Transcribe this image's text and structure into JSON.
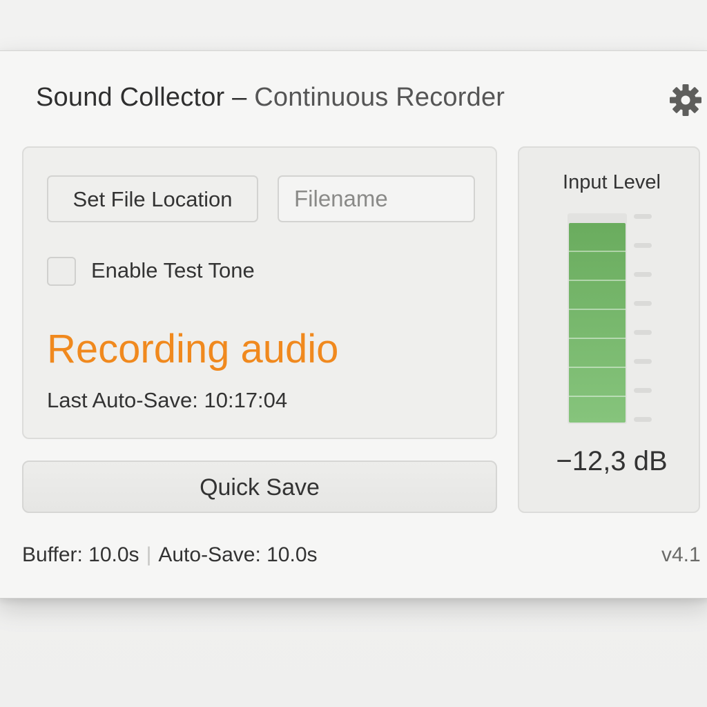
{
  "window": {
    "title_main": "Sound Collector",
    "title_dash": " – ",
    "title_sub": "Continuous Recorder",
    "settings_icon": "gear-icon"
  },
  "controls": {
    "set_location_label": "Set File Location",
    "filename_placeholder": "Filename",
    "filename_value": "",
    "test_tone_label": "Enable Test Tone",
    "test_tone_checked": false
  },
  "status": {
    "text": "Recording audio",
    "color": "#f0891e",
    "last_autosave": "Last Auto-Save: 10:17:04"
  },
  "quick_save_label": "Quick Save",
  "meter": {
    "title": "Input Level",
    "level_fraction": 0.96,
    "fill_color": "#79b96e",
    "readout": "−12,3 dB"
  },
  "footer": {
    "buffer": "Buffer: 10.0s",
    "separator": "|",
    "autosave": "Auto-Save: 10.0s",
    "version": "v4.1"
  }
}
